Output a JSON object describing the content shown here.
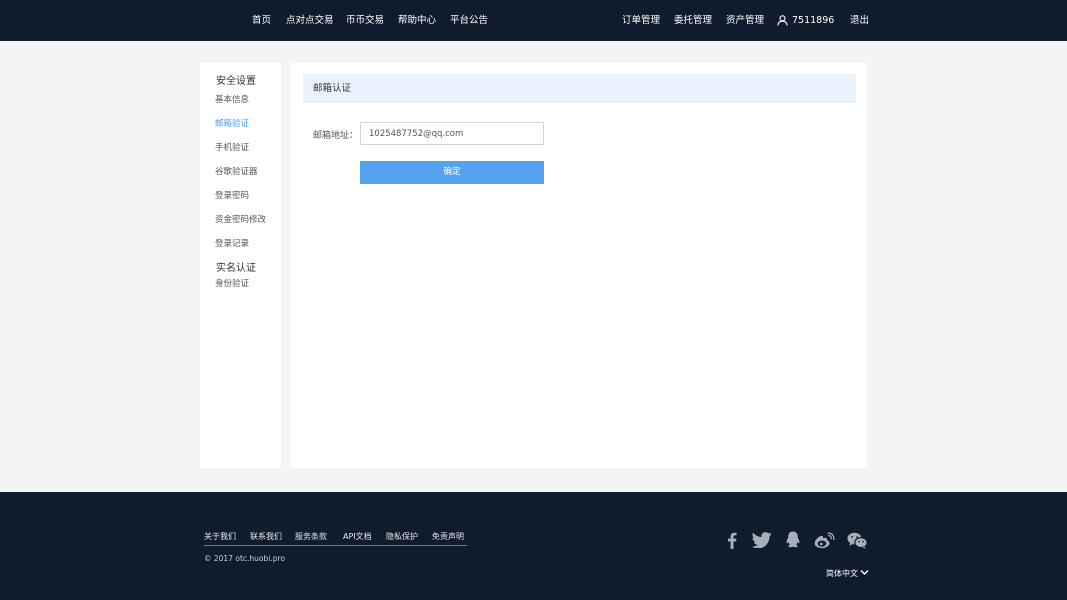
{
  "nav": {
    "home": "首页",
    "p2p": "点对点交易",
    "coin": "币币交易",
    "help": "帮助中心",
    "notice": "平台公告",
    "orders": "订单管理",
    "entrust": "委托管理",
    "assets": "资产管理",
    "user_id": "7511896",
    "logout": "退出",
    "user_icon": "user-icon"
  },
  "sidebar": {
    "security_group": "安全设置",
    "items": [
      "基本信息",
      "邮箱验证",
      "手机验证",
      "谷歌验证器",
      "登录密码",
      "资金密码修改",
      "登录记录"
    ],
    "active_index": 1,
    "realname_group": "实名认证",
    "realname_items": [
      "身份验证"
    ]
  },
  "panel": {
    "title": "邮箱认证",
    "field_label": "邮箱地址：",
    "email_value": "1025487752@qq.com",
    "confirm_label": "确定"
  },
  "footer": {
    "links": [
      "关于我们",
      "联系我们",
      "服务条款",
      "API文档",
      "隐私保护",
      "免责声明"
    ],
    "copyright": "© 2017 otc.huobi.pro",
    "language": "简体中文",
    "social_icons": [
      "facebook-icon",
      "twitter-icon",
      "qq-icon",
      "weibo-icon",
      "wechat-icon"
    ]
  },
  "colors": {
    "header_bg": "#111b2e",
    "accent": "#4a9af0",
    "button": "#55a2ef",
    "panel_header": "#eaf2fd"
  }
}
